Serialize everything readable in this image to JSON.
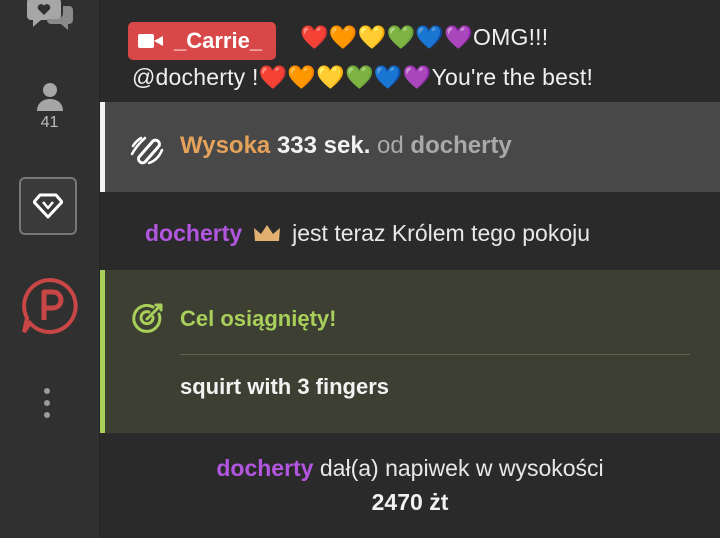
{
  "sidebar": {
    "users_count": "41"
  },
  "messages": {
    "top": {
      "host_name": "_Carrie_",
      "line1": "❤️🧡💛💚💙💜OMG!!!",
      "line2": "@docherty !❤️🧡💛💚💙💜You're the best!"
    },
    "tip_level": {
      "level": "Wysoka",
      "duration": "333 sek.",
      "from_word": "od",
      "user": "docherty"
    },
    "king": {
      "user": "docherty",
      "text": "jest teraz Królem tego pokoju"
    },
    "goal": {
      "title": "Cel osiągnięty!",
      "description": "squirt with 3 fingers"
    },
    "tip": {
      "user": "docherty",
      "text": "dał(a) napiwek w wysokości",
      "amount": "2470 żt"
    }
  },
  "colors": {
    "accent_red": "#d84848",
    "purple_user": "#b256e0",
    "goal_green": "#a9cf5b",
    "orange_level": "#e4a25a"
  }
}
